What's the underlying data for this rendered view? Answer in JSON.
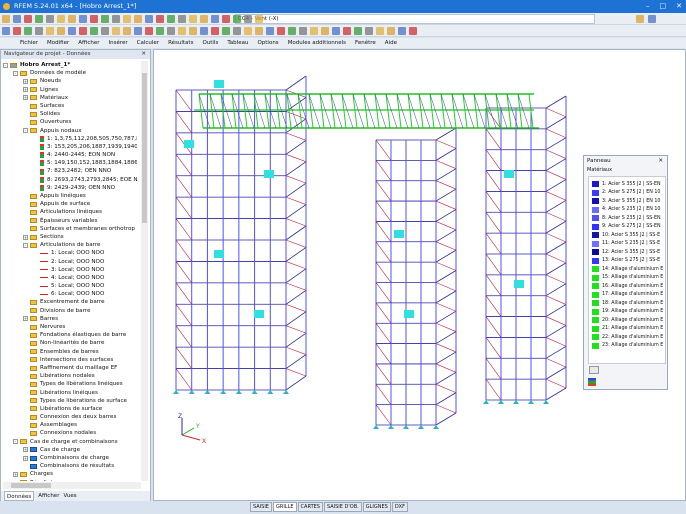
{
  "window": {
    "title": "RFEM 5.24.01 x64 - [Hobro Arrest_1*]"
  },
  "toolbar": {
    "load_case": "CC4 - Vent (-X)"
  },
  "menu": [
    "Fichier",
    "Modifier",
    "Afficher",
    "Insérer",
    "Calculer",
    "Résultats",
    "Outils",
    "Tableau",
    "Options",
    "Modules additionnels",
    "Fenêtre",
    "Aide"
  ],
  "navigator": {
    "title": "Navigateur de projet - Données",
    "items": [
      {
        "label": "Hobro Arrest_1*",
        "level": 0,
        "icon": "project",
        "exp": "-"
      },
      {
        "label": "Données de modèle",
        "level": 1,
        "icon": "folder",
        "exp": "-"
      },
      {
        "label": "Noeuds",
        "level": 2,
        "icon": "folder",
        "exp": "+"
      },
      {
        "label": "Lignes",
        "level": 2,
        "icon": "folder",
        "exp": "+"
      },
      {
        "label": "Matériaux",
        "level": 2,
        "icon": "folder",
        "exp": "+"
      },
      {
        "label": "Surfaces",
        "level": 2,
        "icon": "folder"
      },
      {
        "label": "Solides",
        "level": 2,
        "icon": "folder"
      },
      {
        "label": "Ouvertures",
        "level": 2,
        "icon": "folder"
      },
      {
        "label": "Appuis nodaux",
        "level": 2,
        "icon": "folder",
        "exp": "-"
      },
      {
        "label": "1: 1,3,75,112,208,505,750,787,8",
        "level": 3,
        "icon": "support"
      },
      {
        "label": "3: 153,205,206,1887,1939,1940,",
        "level": 3,
        "icon": "support"
      },
      {
        "label": "4: 2440-2445; EON NON",
        "level": 3,
        "icon": "support"
      },
      {
        "label": "5: 149,150,152,1883,1884,1886;",
        "level": 3,
        "icon": "support"
      },
      {
        "label": "7: 823,2482; OEN NNO",
        "level": 3,
        "icon": "support"
      },
      {
        "label": "8: 2693,2743,2793,2845; EOE N",
        "level": 3,
        "icon": "support"
      },
      {
        "label": "9: 2429-2439; OEN NNO",
        "level": 3,
        "icon": "support"
      },
      {
        "label": "Appuis linéiques",
        "level": 2,
        "icon": "folder"
      },
      {
        "label": "Appuis de surface",
        "level": 2,
        "icon": "folder"
      },
      {
        "label": "Articulations linéiques",
        "level": 2,
        "icon": "folder"
      },
      {
        "label": "Épaisseurs variables",
        "level": 2,
        "icon": "folder"
      },
      {
        "label": "Surfaces et membranes orthotrop",
        "level": 2,
        "icon": "folder"
      },
      {
        "label": "Sections",
        "level": 2,
        "icon": "folder",
        "exp": "+"
      },
      {
        "label": "Articulations de barre",
        "level": 2,
        "icon": "folder",
        "exp": "-"
      },
      {
        "label": "1: Local; OOO NOO",
        "level": 3,
        "icon": "hinge"
      },
      {
        "label": "2: Local; OOO NOO",
        "level": 3,
        "icon": "hinge"
      },
      {
        "label": "3: Local; OOO NOO",
        "level": 3,
        "icon": "hinge"
      },
      {
        "label": "4: Local; OOO NOO",
        "level": 3,
        "icon": "hinge"
      },
      {
        "label": "5: Local; OOO NOO",
        "level": 3,
        "icon": "hinge"
      },
      {
        "label": "6: Local; OOO NOO",
        "level": 3,
        "icon": "hinge"
      },
      {
        "label": "Excentrement de barre",
        "level": 2,
        "icon": "folder"
      },
      {
        "label": "Divisions de barre",
        "level": 2,
        "icon": "folder"
      },
      {
        "label": "Barres",
        "level": 2,
        "icon": "folder",
        "exp": "+"
      },
      {
        "label": "Nervures",
        "level": 2,
        "icon": "folder"
      },
      {
        "label": "Fondations élastiques de barre",
        "level": 2,
        "icon": "folder"
      },
      {
        "label": "Non-linéarités de barre",
        "level": 2,
        "icon": "folder"
      },
      {
        "label": "Ensembles de barres",
        "level": 2,
        "icon": "folder"
      },
      {
        "label": "Intersections des surfaces",
        "level": 2,
        "icon": "folder"
      },
      {
        "label": "Raffinement du maillage EF",
        "level": 2,
        "icon": "folder"
      },
      {
        "label": "Libérations nodales",
        "level": 2,
        "icon": "folder"
      },
      {
        "label": "Types de libérations linéiques",
        "level": 2,
        "icon": "folder"
      },
      {
        "label": "Libérations linéiques",
        "level": 2,
        "icon": "folder"
      },
      {
        "label": "Types de libérations de surface",
        "level": 2,
        "icon": "folder"
      },
      {
        "label": "Libérations de surface",
        "level": 2,
        "icon": "folder"
      },
      {
        "label": "Connexion des deux barres",
        "level": 2,
        "icon": "folder"
      },
      {
        "label": "Assemblages",
        "level": 2,
        "icon": "folder"
      },
      {
        "label": "Connexions nodales",
        "level": 2,
        "icon": "folder"
      },
      {
        "label": "Cas de charge et combinaisons",
        "level": 1,
        "icon": "folder",
        "exp": "-"
      },
      {
        "label": "Cas de charge",
        "level": 2,
        "icon": "lc",
        "exp": "+"
      },
      {
        "label": "Combinaisons de charge",
        "level": 2,
        "icon": "lc",
        "exp": "+"
      },
      {
        "label": "Combinaisons de résultats",
        "level": 2,
        "icon": "lc"
      },
      {
        "label": "Charges",
        "level": 1,
        "icon": "folder",
        "exp": "+"
      },
      {
        "label": "Résultats",
        "level": 1,
        "icon": "folder"
      }
    ],
    "tabs": [
      "Données",
      "Afficher",
      "Vues"
    ]
  },
  "panel": {
    "title": "Panneau",
    "section": "Matériaux",
    "materials": [
      {
        "label": "1: Acier S 355 J2 | SS-EN",
        "color": "#1a1ac8"
      },
      {
        "label": "2: Acier S 275 J2 | EN 10",
        "color": "#3a3aff"
      },
      {
        "label": "3: Acier S 355 J2 | EN 10",
        "color": "#1010b0"
      },
      {
        "label": "4: Acier S 235 J2 | EN 10",
        "color": "#6a6aff"
      },
      {
        "label": "8: Acier S 235 J2 | SS-EN",
        "color": "#5050f0"
      },
      {
        "label": "9: Acier S 275 J2 | SS-EN",
        "color": "#3030ff"
      },
      {
        "label": "10: Acier S 355 J2 | SS-E",
        "color": "#1515a8"
      },
      {
        "label": "11: Acier S 235 J2 | SS-E",
        "color": "#7070ff"
      },
      {
        "label": "12: Acier S 355 J2 | SS-E",
        "color": "#0a0a98"
      },
      {
        "label": "13: Acier S 275 J2 | SS-E",
        "color": "#3535ff"
      },
      {
        "label": "14: Alliage d'aluminium E",
        "color": "#1ee01e"
      },
      {
        "label": "15: Alliage d'aluminium E",
        "color": "#1ee01e"
      },
      {
        "label": "16: Alliage d'aluminium E",
        "color": "#1ee01e"
      },
      {
        "label": "17: Alliage d'aluminium E",
        "color": "#1ee01e"
      },
      {
        "label": "18: Alliage d'aluminium E",
        "color": "#1ee01e"
      },
      {
        "label": "19: Alliage d'aluminium E",
        "color": "#1ee01e"
      },
      {
        "label": "20: Alliage d'aluminium E",
        "color": "#1ee01e"
      },
      {
        "label": "21: Alliage d'aluminium E",
        "color": "#1ee01e"
      },
      {
        "label": "22: Alliage d'aluminium E",
        "color": "#1ee01e"
      },
      {
        "label": "23: Alliage d'aluminium E",
        "color": "#1ee01e"
      }
    ]
  },
  "axes": {
    "x": "X",
    "y": "Y",
    "z": "Z"
  },
  "bottom_tabs": [
    "SAISIE",
    "GRILLE",
    "CARTES",
    "SAISIE D'OB.",
    "GLIGNES",
    "DXF"
  ]
}
